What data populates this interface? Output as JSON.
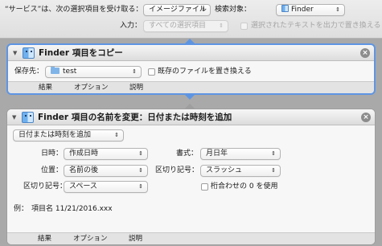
{
  "header": {
    "receives_label": "“サービス”は、次の選択項目を受け取る：",
    "receives_value": "イメージファイル",
    "search_label": "検索対象：",
    "search_value": "Finder",
    "input_label": "入力：",
    "input_value": "すべての選択項目",
    "replace_text_label": "選択されたテキストを出力で置き換える"
  },
  "action1": {
    "title": "Finder 項目をコピー",
    "save_to_label": "保存先：",
    "save_to_value": "test",
    "replace_existing_label": "既存のファイルを置き換える",
    "tabs": [
      "結果",
      "オプション",
      "説明"
    ]
  },
  "action2": {
    "title": "Finder 項目の名前を変更：日付または時刻を追加",
    "mode_value": "日付または時刻を追加",
    "date_time_label": "日時：",
    "date_time_value": "作成日時",
    "format_label": "書式：",
    "format_value": "月日年",
    "position_label": "位置：",
    "position_value": "名前の後",
    "separator_label": "区切り記号：",
    "separator_value": "スラッシュ",
    "separator2_label": "区切り記号：",
    "separator2_value": "スペース",
    "zero_pad_label": "桁合わせの 0 を使用",
    "example_label": "例：",
    "example_value": "項目名 11/21/2016.xxx",
    "tabs": [
      "結果",
      "オプション",
      "説明"
    ]
  },
  "icons": {
    "popup_arrows": "⇕",
    "disclosure": "▼",
    "close": "×"
  }
}
